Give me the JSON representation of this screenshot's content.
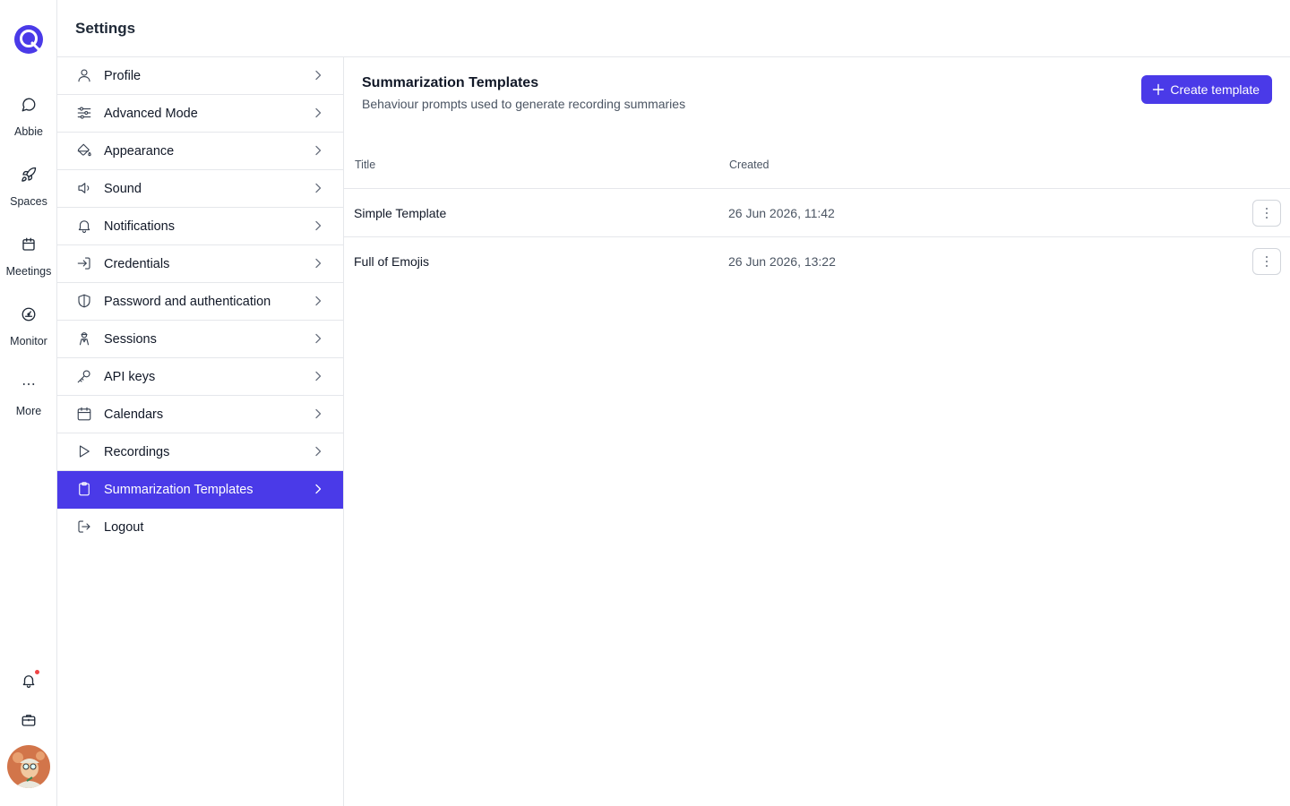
{
  "app": {
    "brand_color": "#4a3ae8"
  },
  "rail": {
    "logo_icon": "brand-logo-icon",
    "items": [
      {
        "label": "Abbie",
        "icon": "chat-bubble-icon"
      },
      {
        "label": "Spaces",
        "icon": "rocket-icon"
      },
      {
        "label": "Meetings",
        "icon": "calendar-icon"
      },
      {
        "label": "Monitor",
        "icon": "gauge-icon"
      },
      {
        "label": "More",
        "icon": "ellipsis-icon"
      }
    ],
    "bottom": [
      {
        "icon": "bell-icon",
        "has_unread": true
      },
      {
        "icon": "briefcase-icon"
      }
    ]
  },
  "header": {
    "title": "Settings"
  },
  "settings_menu": {
    "items": [
      {
        "label": "Profile",
        "icon": "user-icon"
      },
      {
        "label": "Advanced Mode",
        "icon": "sliders-icon"
      },
      {
        "label": "Appearance",
        "icon": "paint-bucket-icon"
      },
      {
        "label": "Sound",
        "icon": "speaker-icon"
      },
      {
        "label": "Notifications",
        "icon": "bell-icon"
      },
      {
        "label": "Credentials",
        "icon": "sign-in-icon"
      },
      {
        "label": "Password and authentication",
        "icon": "shield-icon"
      },
      {
        "label": "Sessions",
        "icon": "agent-icon"
      },
      {
        "label": "API keys",
        "icon": "key-icon"
      },
      {
        "label": "Calendars",
        "icon": "calendar-icon"
      },
      {
        "label": "Recordings",
        "icon": "play-icon"
      },
      {
        "label": "Summarization Templates",
        "icon": "clipboard-icon",
        "active": true
      },
      {
        "label": "Logout",
        "icon": "logout-icon"
      }
    ]
  },
  "main": {
    "title": "Summarization Templates",
    "subtitle": "Behaviour prompts used to generate recording summaries",
    "create_button": "Create template",
    "table": {
      "columns": [
        "Title",
        "Created"
      ],
      "rows": [
        {
          "title": "Simple Template",
          "created": "26 Jun 2026, 11:42"
        },
        {
          "title": "Full of Emojis",
          "created": "26 Jun 2026, 13:22"
        }
      ]
    }
  }
}
